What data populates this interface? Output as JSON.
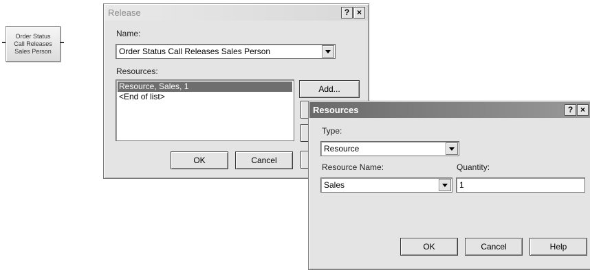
{
  "module": {
    "lines": [
      "Order Status",
      "Call Releases",
      "Sales Person"
    ]
  },
  "release": {
    "title": "Release",
    "help_btn": "?",
    "close_btn": "×",
    "name_label": "Name:",
    "name_value": "Order Status Call Releases Sales Person",
    "resources_label": "Resources:",
    "list_items": [
      "Resource, Sales, 1",
      "<End of list>"
    ],
    "selected_index": 0,
    "add_label": "Add...",
    "ok_label": "OK",
    "cancel_label": "Cancel"
  },
  "resources_dialog": {
    "title": "Resources",
    "help_btn": "?",
    "close_btn": "×",
    "type_label": "Type:",
    "type_value": "Resource",
    "resource_name_label": "Resource Name:",
    "resource_name_value": "Sales",
    "quantity_label": "Quantity:",
    "quantity_value": "1",
    "ok_label": "OK",
    "cancel_label": "Cancel",
    "help_label": "Help"
  }
}
